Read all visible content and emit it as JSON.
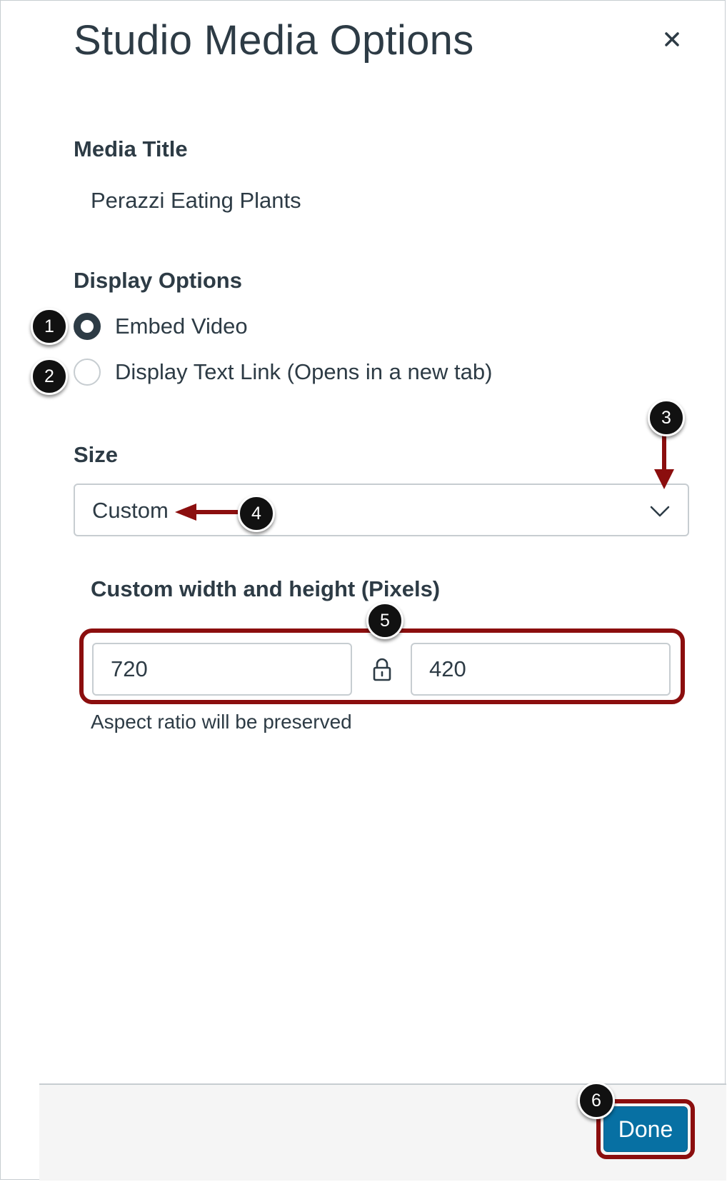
{
  "modal": {
    "title": "Studio Media Options",
    "close_icon": "close-icon"
  },
  "media_title": {
    "label": "Media Title",
    "value": "Perazzi Eating Plants"
  },
  "display_options": {
    "label": "Display Options",
    "options": [
      {
        "label": "Embed Video",
        "checked": true
      },
      {
        "label": "Display Text Link (Opens in a new tab)",
        "checked": false
      }
    ]
  },
  "size": {
    "label": "Size",
    "selected": "Custom",
    "icon": "chevron-down-icon"
  },
  "custom_size": {
    "label": "Custom width and height (Pixels)",
    "width": "720",
    "height": "420",
    "lock_icon": "lock-icon",
    "hint": "Aspect ratio will be preserved"
  },
  "footer": {
    "done_label": "Done"
  },
  "callouts": [
    "1",
    "2",
    "3",
    "4",
    "5",
    "6"
  ],
  "colors": {
    "text": "#2D3B45",
    "primary_button": "#0770A3",
    "callout_red": "#8B0E0E",
    "border": "#C7CDD1",
    "footer_bg": "#F5F5F5"
  }
}
